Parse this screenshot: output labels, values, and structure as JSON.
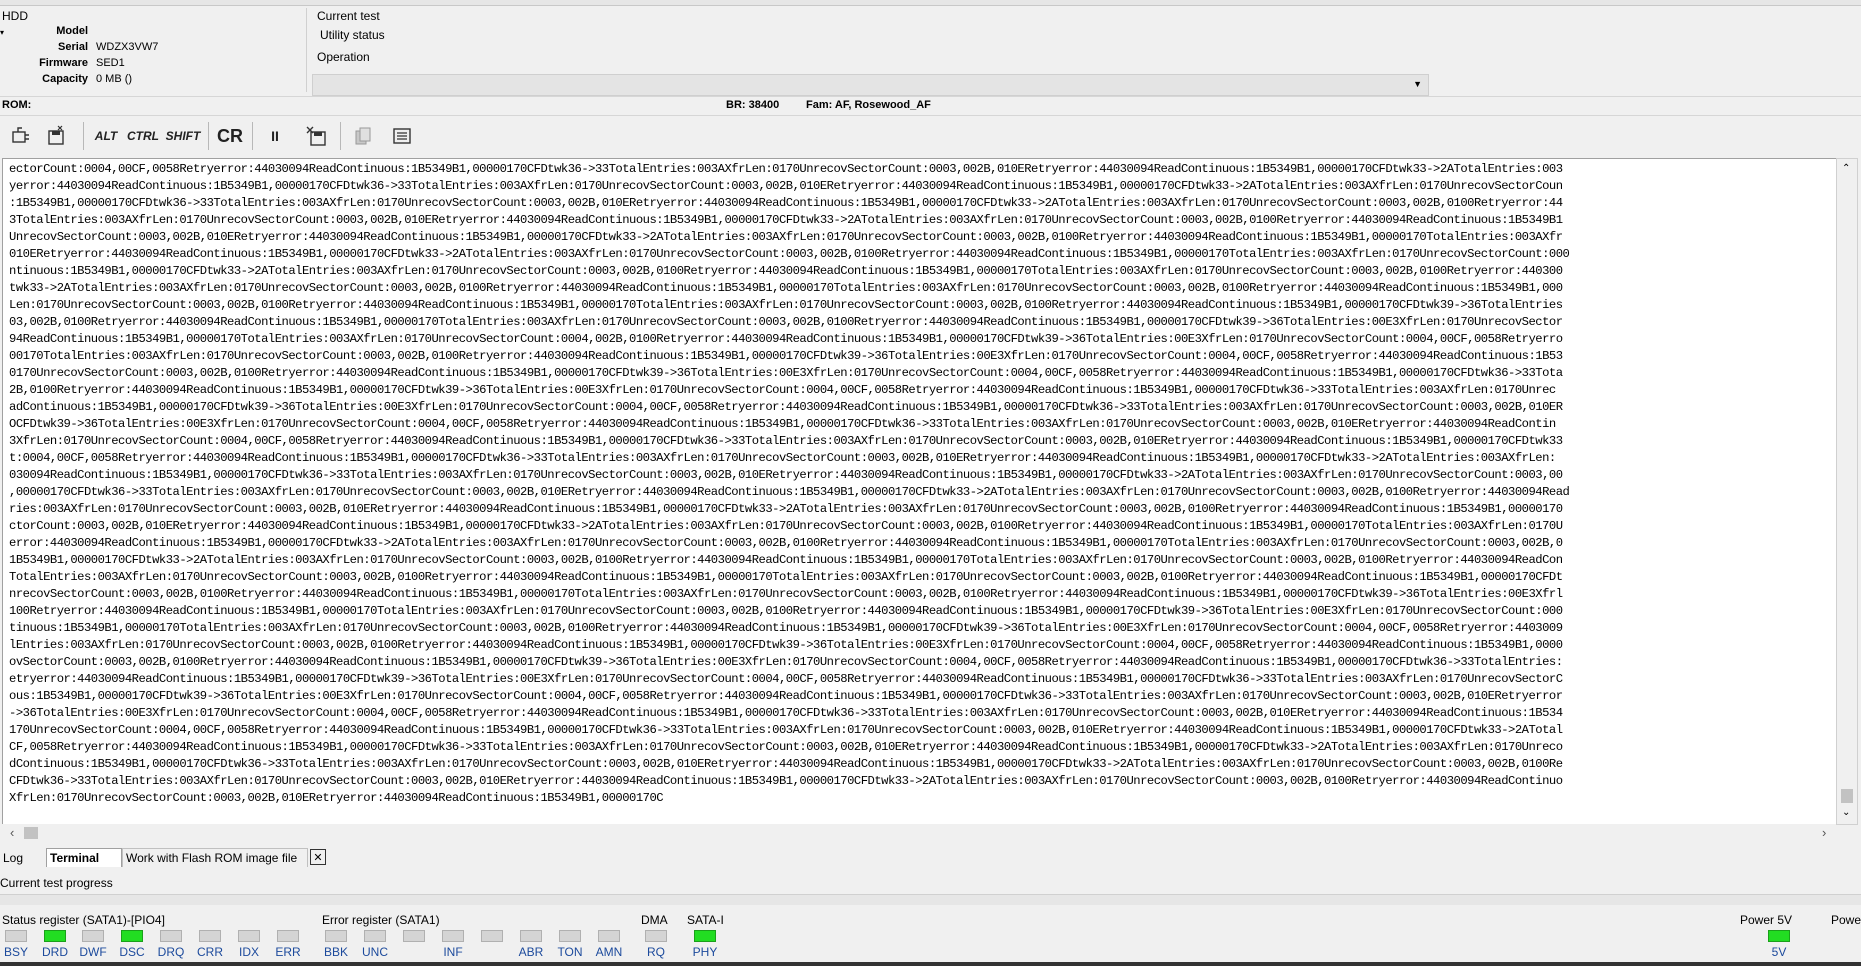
{
  "hdd": {
    "title": "HDD",
    "model_label": "Model",
    "model_value": "",
    "serial_label": "Serial",
    "serial_value": "WDZX3VW7",
    "firmware_label": "Firmware",
    "firmware_value": "SED1",
    "capacity_label": "Capacity",
    "capacity_value": "0 MB ()"
  },
  "status_panel": {
    "current_test": "Current test",
    "utility_status": "Utility status",
    "operation": "Operation"
  },
  "rom_bar": {
    "rom": "ROM:",
    "br": "BR: 38400",
    "fam": "Fam: AF, Rosewood_AF"
  },
  "toolbar": {
    "alt": "ALT",
    "ctrl": "CTRL",
    "shift": "SHIFT",
    "cr": "CR",
    "pause": "II"
  },
  "terminal_lines": [
    "ectorCount:0004,00CF,0058Retryerror:44030094ReadContinuous:1B5349B1,00000170CFDtwk36->33TotalEntries:003AXfrLen:0170UnrecovSectorCount:0003,002B,010ERetryerror:44030094ReadContinuous:1B5349B1,00000170CFDtwk33->2ATotalEntries:003",
    "yerror:44030094ReadContinuous:1B5349B1,00000170CFDtwk36->33TotalEntries:003AXfrLen:0170UnrecovSectorCount:0003,002B,010ERetryerror:44030094ReadContinuous:1B5349B1,00000170CFDtwk33->2ATotalEntries:003AXfrLen:0170UnrecovSectorCoun",
    ":1B5349B1,00000170CFDtwk36->33TotalEntries:003AXfrLen:0170UnrecovSectorCount:0003,002B,010ERetryerror:44030094ReadContinuous:1B5349B1,00000170CFDtwk33->2ATotalEntries:003AXfrLen:0170UnrecovSectorCount:0003,002B,0100Retryerror:44",
    "3TotalEntries:003AXfrLen:0170UnrecovSectorCount:0003,002B,010ERetryerror:44030094ReadContinuous:1B5349B1,00000170CFDtwk33->2ATotalEntries:003AXfrLen:0170UnrecovSectorCount:0003,002B,0100Retryerror:44030094ReadContinuous:1B5349B1",
    "UnrecovSectorCount:0003,002B,010ERetryerror:44030094ReadContinuous:1B5349B1,00000170CFDtwk33->2ATotalEntries:003AXfrLen:0170UnrecovSectorCount:0003,002B,0100Retryerror:44030094ReadContinuous:1B5349B1,00000170TotalEntries:003AXfr",
    "010ERetryerror:44030094ReadContinuous:1B5349B1,00000170CFDtwk33->2ATotalEntries:003AXfrLen:0170UnrecovSectorCount:0003,002B,0100Retryerror:44030094ReadContinuous:1B5349B1,00000170TotalEntries:003AXfrLen:0170UnrecovSectorCount:000",
    "ntinuous:1B5349B1,00000170CFDtwk33->2ATotalEntries:003AXfrLen:0170UnrecovSectorCount:0003,002B,0100Retryerror:44030094ReadContinuous:1B5349B1,00000170TotalEntries:003AXfrLen:0170UnrecovSectorCount:0003,002B,0100Retryerror:440300",
    "twk33->2ATotalEntries:003AXfrLen:0170UnrecovSectorCount:0003,002B,0100Retryerror:44030094ReadContinuous:1B5349B1,00000170TotalEntries:003AXfrLen:0170UnrecovSectorCount:0003,002B,0100Retryerror:44030094ReadContinuous:1B5349B1,000",
    "Len:0170UnrecovSectorCount:0003,002B,0100Retryerror:44030094ReadContinuous:1B5349B1,00000170TotalEntries:003AXfrLen:0170UnrecovSectorCount:0003,002B,0100Retryerror:44030094ReadContinuous:1B5349B1,00000170CFDtwk39->36TotalEntries",
    "03,002B,0100Retryerror:44030094ReadContinuous:1B5349B1,00000170TotalEntries:003AXfrLen:0170UnrecovSectorCount:0003,002B,0100Retryerror:44030094ReadContinuous:1B5349B1,00000170CFDtwk39->36TotalEntries:00E3XfrLen:0170UnrecovSector",
    "94ReadContinuous:1B5349B1,00000170TotalEntries:003AXfrLen:0170UnrecovSectorCount:0004,002B,0100Retryerror:44030094ReadContinuous:1B5349B1,00000170CFDtwk39->36TotalEntries:00E3XfrLen:0170UnrecovSectorCount:0004,00CF,0058Retryerro",
    "00170TotalEntries:003AXfrLen:0170UnrecovSectorCount:0003,002B,0100Retryerror:44030094ReadContinuous:1B5349B1,00000170CFDtwk39->36TotalEntries:00E3XfrLen:0170UnrecovSectorCount:0004,00CF,0058Retryerror:44030094ReadContinuous:1B53",
    "0170UnrecovSectorCount:0003,002B,0100Retryerror:44030094ReadContinuous:1B5349B1,00000170CFDtwk39->36TotalEntries:00E3XfrLen:0170UnrecovSectorCount:0004,00CF,0058Retryerror:44030094ReadContinuous:1B5349B1,00000170CFDtwk36->33Tota",
    "2B,0100Retryerror:44030094ReadContinuous:1B5349B1,00000170CFDtwk39->36TotalEntries:00E3XfrLen:0170UnrecovSectorCount:0004,00CF,0058Retryerror:44030094ReadContinuous:1B5349B1,00000170CFDtwk36->33TotalEntries:003AXfrLen:0170Unrec",
    "adContinuous:1B5349B1,00000170CFDtwk39->36TotalEntries:00E3XfrLen:0170UnrecovSectorCount:0004,00CF,0058Retryerror:44030094ReadContinuous:1B5349B1,00000170CFDtwk36->33TotalEntries:003AXfrLen:0170UnrecovSectorCount:0003,002B,010ER",
    "OCFDtwk39->36TotalEntries:00E3XfrLen:0170UnrecovSectorCount:0004,00CF,0058Retryerror:44030094ReadContinuous:1B5349B1,00000170CFDtwk36->33TotalEntries:003AXfrLen:0170UnrecovSectorCount:0003,002B,010ERetryerror:44030094ReadContin",
    "3XfrLen:0170UnrecovSectorCount:0004,00CF,0058Retryerror:44030094ReadContinuous:1B5349B1,00000170CFDtwk36->33TotalEntries:003AXfrLen:0170UnrecovSectorCount:0003,002B,010ERetryerror:44030094ReadContinuous:1B5349B1,00000170CFDtwk33",
    "t:0004,00CF,0058Retryerror:44030094ReadContinuous:1B5349B1,00000170CFDtwk36->33TotalEntries:003AXfrLen:0170UnrecovSectorCount:0003,002B,010ERetryerror:44030094ReadContinuous:1B5349B1,00000170CFDtwk33->2ATotalEntries:003AXfrLen:",
    "030094ReadContinuous:1B5349B1,00000170CFDtwk36->33TotalEntries:003AXfrLen:0170UnrecovSectorCount:0003,002B,010ERetryerror:44030094ReadContinuous:1B5349B1,00000170CFDtwk33->2ATotalEntries:003AXfrLen:0170UnrecovSectorCount:0003,00",
    ",00000170CFDtwk36->33TotalEntries:003AXfrLen:0170UnrecovSectorCount:0003,002B,010ERetryerror:44030094ReadContinuous:1B5349B1,00000170CFDtwk33->2ATotalEntries:003AXfrLen:0170UnrecovSectorCount:0003,002B,0100Retryerror:44030094Read",
    "ries:003AXfrLen:0170UnrecovSectorCount:0003,002B,010ERetryerror:44030094ReadContinuous:1B5349B1,00000170CFDtwk33->2ATotalEntries:003AXfrLen:0170UnrecovSectorCount:0003,002B,0100Retryerror:44030094ReadContinuous:1B5349B1,00000170",
    "ctorCount:0003,002B,010ERetryerror:44030094ReadContinuous:1B5349B1,00000170CFDtwk33->2ATotalEntries:003AXfrLen:0170UnrecovSectorCount:0003,002B,0100Retryerror:44030094ReadContinuous:1B5349B1,00000170TotalEntries:003AXfrLen:0170U",
    "error:44030094ReadContinuous:1B5349B1,00000170CFDtwk33->2ATotalEntries:003AXfrLen:0170UnrecovSectorCount:0003,002B,0100Retryerror:44030094ReadContinuous:1B5349B1,00000170TotalEntries:003AXfrLen:0170UnrecovSectorCount:0003,002B,0",
    "1B5349B1,00000170CFDtwk33->2ATotalEntries:003AXfrLen:0170UnrecovSectorCount:0003,002B,0100Retryerror:44030094ReadContinuous:1B5349B1,00000170TotalEntries:003AXfrLen:0170UnrecovSectorCount:0003,002B,0100Retryerror:44030094ReadCon",
    "TotalEntries:003AXfrLen:0170UnrecovSectorCount:0003,002B,0100Retryerror:44030094ReadContinuous:1B5349B1,00000170TotalEntries:003AXfrLen:0170UnrecovSectorCount:0003,002B,0100Retryerror:44030094ReadContinuous:1B5349B1,00000170CFDt",
    "nrecovSectorCount:0003,002B,0100Retryerror:44030094ReadContinuous:1B5349B1,00000170TotalEntries:003AXfrLen:0170UnrecovSectorCount:0003,002B,0100Retryerror:44030094ReadContinuous:1B5349B1,00000170CFDtwk39->36TotalEntries:00E3Xfrl",
    "100Retryerror:44030094ReadContinuous:1B5349B1,00000170TotalEntries:003AXfrLen:0170UnrecovSectorCount:0003,002B,0100Retryerror:44030094ReadContinuous:1B5349B1,00000170CFDtwk39->36TotalEntries:00E3XfrLen:0170UnrecovSectorCount:000",
    "tinuous:1B5349B1,00000170TotalEntries:003AXfrLen:0170UnrecovSectorCount:0003,002B,0100Retryerror:44030094ReadContinuous:1B5349B1,00000170CFDtwk39->36TotalEntries:00E3XfrLen:0170UnrecovSectorCount:0004,00CF,0058Retryerror:4403009",
    "lEntries:003AXfrLen:0170UnrecovSectorCount:0003,002B,0100Retryerror:44030094ReadContinuous:1B5349B1,00000170CFDtwk39->36TotalEntries:00E3XfrLen:0170UnrecovSectorCount:0004,00CF,0058Retryerror:44030094ReadContinuous:1B5349B1,0000",
    "ovSectorCount:0003,002B,0100Retryerror:44030094ReadContinuous:1B5349B1,00000170CFDtwk39->36TotalEntries:00E3XfrLen:0170UnrecovSectorCount:0004,00CF,0058Retryerror:44030094ReadContinuous:1B5349B1,00000170CFDtwk36->33TotalEntries:",
    "etryerror:44030094ReadContinuous:1B5349B1,00000170CFDtwk39->36TotalEntries:00E3XfrLen:0170UnrecovSectorCount:0004,00CF,0058Retryerror:44030094ReadContinuous:1B5349B1,00000170CFDtwk36->33TotalEntries:003AXfrLen:0170UnrecovSectorC",
    "ous:1B5349B1,00000170CFDtwk39->36TotalEntries:00E3XfrLen:0170UnrecovSectorCount:0004,00CF,0058Retryerror:44030094ReadContinuous:1B5349B1,00000170CFDtwk36->33TotalEntries:003AXfrLen:0170UnrecovSectorCount:0003,002B,010ERetryerror",
    "->36TotalEntries:00E3XfrLen:0170UnrecovSectorCount:0004,00CF,0058Retryerror:44030094ReadContinuous:1B5349B1,00000170CFDtwk36->33TotalEntries:003AXfrLen:0170UnrecovSectorCount:0003,002B,010ERetryerror:44030094ReadContinuous:1B534",
    "170UnrecovSectorCount:0004,00CF,0058Retryerror:44030094ReadContinuous:1B5349B1,00000170CFDtwk36->33TotalEntries:003AXfrLen:0170UnrecovSectorCount:0003,002B,010ERetryerror:44030094ReadContinuous:1B5349B1,00000170CFDtwk33->2ATotal",
    "CF,0058Retryerror:44030094ReadContinuous:1B5349B1,00000170CFDtwk36->33TotalEntries:003AXfrLen:0170UnrecovSectorCount:0003,002B,010ERetryerror:44030094ReadContinuous:1B5349B1,00000170CFDtwk33->2ATotalEntries:003AXfrLen:0170Unreco",
    "dContinuous:1B5349B1,00000170CFDtwk36->33TotalEntries:003AXfrLen:0170UnrecovSectorCount:0003,002B,010ERetryerror:44030094ReadContinuous:1B5349B1,00000170CFDtwk33->2ATotalEntries:003AXfrLen:0170UnrecovSectorCount:0003,002B,0100Re",
    "CFDtwk36->33TotalEntries:003AXfrLen:0170UnrecovSectorCount:0003,002B,010ERetryerror:44030094ReadContinuous:1B5349B1,00000170CFDtwk33->2ATotalEntries:003AXfrLen:0170UnrecovSectorCount:0003,002B,0100Retryerror:44030094ReadContinuo",
    "XfrLen:0170UnrecovSectorCount:0003,002B,010ERetryerror:44030094ReadContinuous:1B5349B1,00000170C"
  ],
  "tabs": {
    "log": "Log",
    "terminal": "Terminal",
    "flash": "Work with Flash ROM image file",
    "close": "✕"
  },
  "progress": {
    "label": "Current test progress"
  },
  "status_register": {
    "title": "Status register (SATA1)-[PIO4]",
    "leds": [
      {
        "label": "BSY",
        "on": false
      },
      {
        "label": "DRD",
        "on": true
      },
      {
        "label": "DWF",
        "on": false
      },
      {
        "label": "DSC",
        "on": true
      },
      {
        "label": "DRQ",
        "on": false
      },
      {
        "label": "CRR",
        "on": false
      },
      {
        "label": "IDX",
        "on": false
      },
      {
        "label": "ERR",
        "on": false
      }
    ]
  },
  "error_register": {
    "title": "Error register (SATA1)",
    "leds": [
      {
        "label": "BBK",
        "on": false
      },
      {
        "label": "UNC",
        "on": false
      },
      {
        "label": "",
        "on": false
      },
      {
        "label": "INF",
        "on": false
      },
      {
        "label": "",
        "on": false
      },
      {
        "label": "ABR",
        "on": false
      },
      {
        "label": "TON",
        "on": false
      },
      {
        "label": "AMN",
        "on": false
      }
    ]
  },
  "dma": {
    "title": "DMA",
    "label": "RQ",
    "on": false
  },
  "sata": {
    "title": "SATA-I",
    "label": "PHY",
    "on": true
  },
  "power5": {
    "title": "Power 5V",
    "label": "5V",
    "on": true
  },
  "power12": {
    "title": "Powe"
  }
}
